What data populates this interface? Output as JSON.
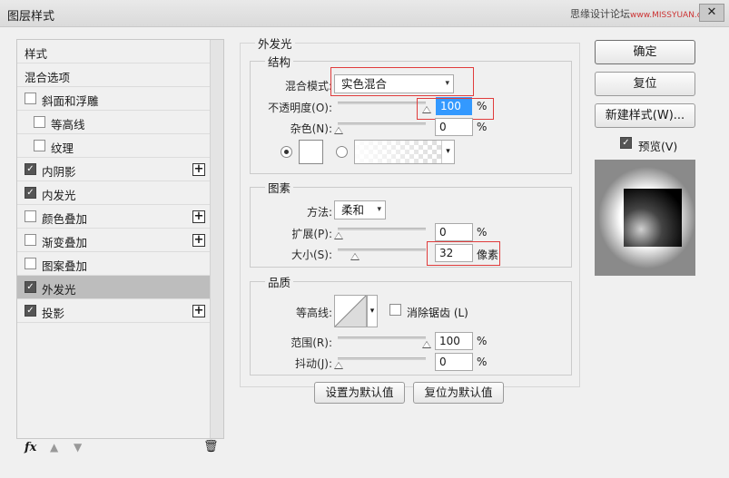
{
  "window": {
    "title": "图层样式",
    "watermark": "思缘设计论坛",
    "watermark_site": "www.MISSYUAN.com",
    "close_glyph": "✕"
  },
  "left_panel": {
    "items": [
      {
        "label": "样式",
        "checkbox": null,
        "plus": false,
        "selected": false
      },
      {
        "label": "混合选项",
        "checkbox": null,
        "plus": false,
        "selected": false
      },
      {
        "label": "斜面和浮雕",
        "checkbox": false,
        "plus": false,
        "selected": false
      },
      {
        "label": "等高线",
        "checkbox": false,
        "plus": false,
        "selected": false
      },
      {
        "label": "纹理",
        "checkbox": false,
        "plus": false,
        "selected": false
      },
      {
        "label": "内阴影",
        "checkbox": true,
        "plus": true,
        "selected": false
      },
      {
        "label": "内发光",
        "checkbox": true,
        "plus": false,
        "selected": false
      },
      {
        "label": "颜色叠加",
        "checkbox": false,
        "plus": true,
        "selected": false
      },
      {
        "label": "渐变叠加",
        "checkbox": false,
        "plus": true,
        "selected": false
      },
      {
        "label": "图案叠加",
        "checkbox": false,
        "plus": false,
        "selected": false
      },
      {
        "label": "外发光",
        "checkbox": true,
        "plus": false,
        "selected": true
      },
      {
        "label": "投影",
        "checkbox": true,
        "plus": true,
        "selected": false
      }
    ],
    "bottom": {
      "fx": "fx",
      "up": "▲",
      "down": "▼",
      "trash": "🗑"
    }
  },
  "outer_glow": {
    "title": "外发光",
    "structure": {
      "title": "结构",
      "blend_mode_label": "混合模式:",
      "blend_mode_value": "实色混合",
      "opacity_label": "不透明度(O):",
      "opacity_value": "100",
      "opacity_fraction": 1.0,
      "noise_label": "杂色(N):",
      "noise_value": "0",
      "noise_fraction": 0,
      "percent": "%"
    },
    "elements": {
      "title": "图素",
      "method_label": "方法:",
      "method_value": "柔和",
      "spread_label": "扩展(P):",
      "spread_value": "0",
      "spread_fraction": 0,
      "size_label": "大小(S):",
      "size_value": "32",
      "size_unit": "像素",
      "percent": "%"
    },
    "quality": {
      "title": "品质",
      "contour_label": "等高线:",
      "antialias_label": "消除锯齿 (L)",
      "antialias_checked": false,
      "range_label": "范围(R):",
      "range_value": "100",
      "range_fraction": 1.0,
      "jitter_label": "抖动(J):",
      "jitter_value": "0",
      "jitter_fraction": 0,
      "percent": "%"
    },
    "set_default": "设置为默认值",
    "reset_default": "复位为默认值"
  },
  "right": {
    "ok": "确定",
    "reset": "复位",
    "new_style": "新建样式(W)...",
    "preview_label": "预览(V)",
    "preview_checked": true
  },
  "colors": {
    "highlight_red": "#e03c3c",
    "selection_blue": "#3399ff",
    "selected_row": "#bdbdbd"
  },
  "icons": {
    "arrow": "▾",
    "check": "✓",
    "plus": "+"
  }
}
